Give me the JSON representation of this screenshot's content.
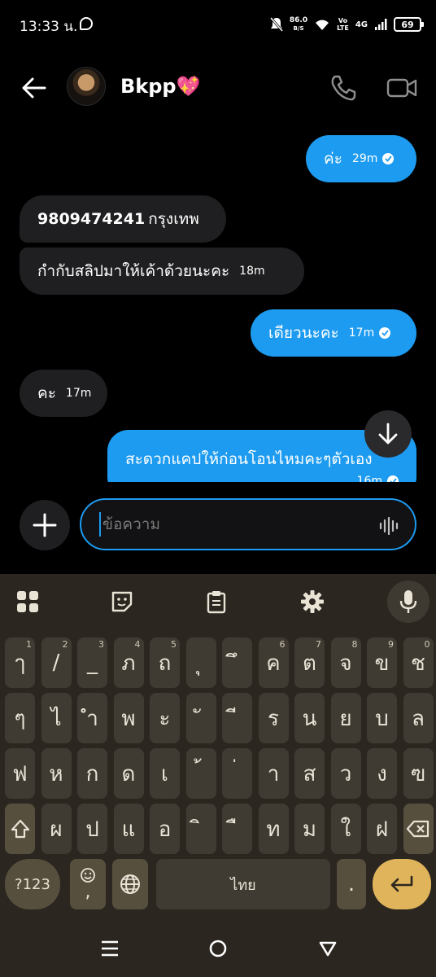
{
  "status_bar": {
    "time": "13:33 น.",
    "speed_value": "86.0",
    "speed_unit": "B/S",
    "volte_top": "Vo",
    "volte_bottom": "LTE",
    "network": "4G",
    "battery": "69"
  },
  "header": {
    "contact_name": "Bkpp💖"
  },
  "messages": [
    {
      "dir": "out",
      "text": "ค่ะ",
      "time": "29m",
      "read": true
    },
    {
      "dir": "in",
      "number": "9809474241",
      "text": "กรุงเทพ"
    },
    {
      "dir": "in",
      "text": "กำกับสลิปมาให้เค้าด้วยนะคะ",
      "time": "18m"
    },
    {
      "dir": "out",
      "text": "เดียวนะคะ",
      "time": "17m",
      "read": true
    },
    {
      "dir": "in",
      "text": "คะ",
      "time": "17m"
    },
    {
      "dir": "out",
      "text": "สะดวกแคปให้ก่อนโอนไหมคะๆตัวเอง",
      "time": "16m",
      "read": true
    }
  ],
  "composer": {
    "placeholder": "ข้อความ"
  },
  "keyboard": {
    "row1": [
      {
        "c": "ๅ",
        "s": "1"
      },
      {
        "c": "/",
        "s": "2"
      },
      {
        "c": "_",
        "s": "3"
      },
      {
        "c": "ภ",
        "s": "4"
      },
      {
        "c": "ถ",
        "s": "5"
      },
      {
        "c": "ุ",
        "s": ""
      },
      {
        "c": "ึ",
        "s": ""
      },
      {
        "c": "ค",
        "s": "6"
      },
      {
        "c": "ต",
        "s": "7"
      },
      {
        "c": "จ",
        "s": "8"
      },
      {
        "c": "ข",
        "s": "9"
      },
      {
        "c": "ช",
        "s": "0"
      }
    ],
    "row2": [
      "ๆ",
      "ไ",
      "ำ",
      "พ",
      "ะ",
      "ั",
      "ี",
      "ร",
      "น",
      "ย",
      "บ",
      "ล"
    ],
    "row3": [
      "ฟ",
      "ห",
      "ก",
      "ด",
      "เ",
      "้",
      "่",
      "า",
      "ส",
      "ว",
      "ง",
      "ฃ"
    ],
    "row4": [
      "ผ",
      "ป",
      "แ",
      "อ",
      "ิ",
      "ื",
      "ท",
      "ม",
      "ใ",
      "ฝ"
    ],
    "numbers_key": "?123",
    "emoji_key_sub": ",",
    "space_label": "ไทย",
    "period_key": "."
  },
  "colors": {
    "accent": "#1d9bf0",
    "keyboard_bg": "#2b2720",
    "key_bg": "#403b32"
  }
}
